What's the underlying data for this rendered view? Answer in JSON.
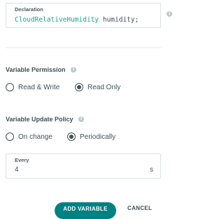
{
  "declaration": {
    "label": "Declaration",
    "type_text": "CloudRelativeHumidity",
    "variable_text": "humidity;"
  },
  "info_icon_glyph": "i",
  "permission": {
    "title": "Variable Permission",
    "options": [
      "Read & Write",
      "Read Only"
    ],
    "selected": "Read Only"
  },
  "update_policy": {
    "title": "Variable Update Policy",
    "options": [
      "On change",
      "Periodically"
    ],
    "selected": "Periodically"
  },
  "every": {
    "label": "Every",
    "value": "4",
    "unit": "s"
  },
  "buttons": {
    "add": "ADD VARIABLE",
    "cancel": "CANCEL"
  },
  "colors": {
    "accent": "#008184",
    "type_color": "#1da086",
    "text": "#434f54"
  }
}
